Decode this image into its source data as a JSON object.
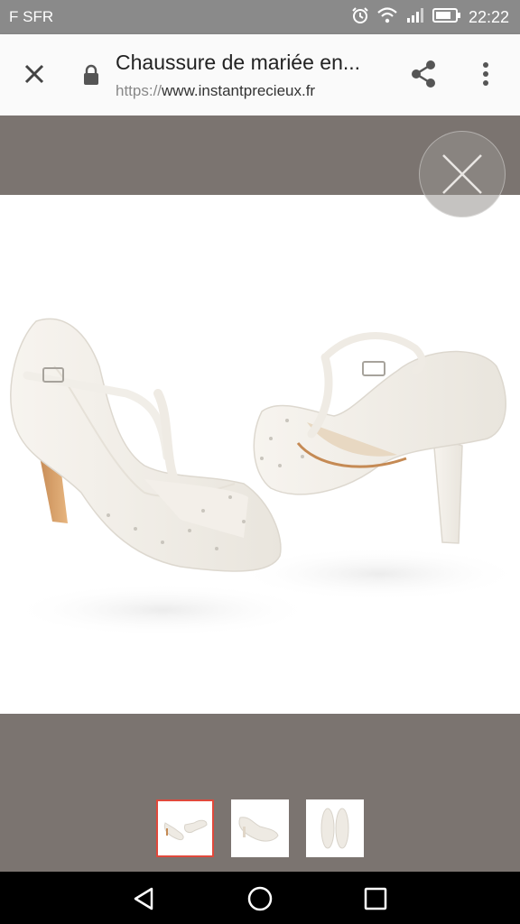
{
  "status_bar": {
    "carrier": "F SFR",
    "time": "22:22",
    "icons": [
      "alarm-icon",
      "wifi-icon",
      "signal-icon",
      "battery-icon"
    ]
  },
  "toolbar": {
    "title": "Chaussure de mariée en...",
    "url_scheme": "https://",
    "url_host": "www.instantprecieux.fr",
    "icons": [
      "close-icon",
      "lock-icon",
      "share-icon",
      "more-vert-icon"
    ]
  },
  "viewer": {
    "image_subject": "white lace T-bar bridal heels",
    "thumbnail_count": 3,
    "selected_thumbnail": 1
  },
  "colors": {
    "status_bar": "#8a8a8a",
    "toolbar": "#fafafa",
    "viewer_background": "#7b7470",
    "selected_thumbnail_border": "#e0493c",
    "nav_bar": "#000000"
  },
  "nav_bar": {
    "icons": [
      "back-icon",
      "home-icon",
      "recents-icon"
    ]
  }
}
